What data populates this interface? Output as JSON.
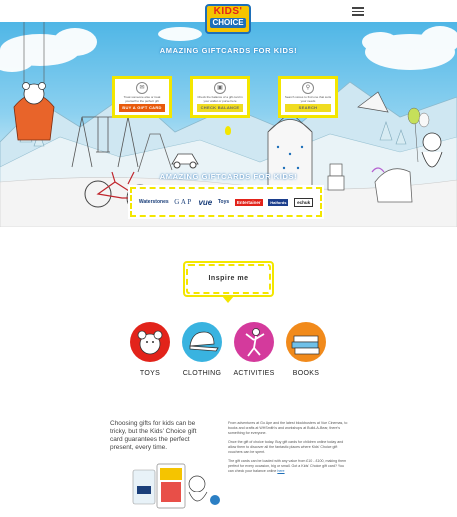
{
  "header": {
    "logo_line1": "KIDS'",
    "logo_line2": "CHOICE",
    "menu_icon": "hamburger-icon"
  },
  "hero": {
    "title": "AMAZING GIFTCARDS FOR KIDS!",
    "title_repeat": "AMAZING GIFTCARDS FOR KIDS!",
    "cards": [
      {
        "text": "Treat someone else or treat yourself to the perfect gift",
        "button": "BUY A GIFT CARD",
        "icon": "gift-card-icon"
      },
      {
        "text": "Check the balance of a gift card in your wallet or purse here",
        "button": "CHECK BALANCE",
        "icon": "card-reader-icon"
      },
      {
        "text": "Search stores to find one that suits your needs",
        "button": "SEARCH",
        "icon": "search-icon"
      }
    ],
    "brands": [
      "Waterstones",
      "GAP",
      "vue",
      "Toys",
      "Entertainer",
      "Halfords",
      "echuk"
    ]
  },
  "inspire": {
    "label": "Inspire me"
  },
  "categories": [
    {
      "label": "TOYS",
      "color": "#e2231a"
    },
    {
      "label": "CLOTHING",
      "color": "#39b3e0"
    },
    {
      "label": "ACTIVITIES",
      "color": "#d43a9c"
    },
    {
      "label": "BOOKS",
      "color": "#f18a1b"
    }
  ],
  "bottom": {
    "intro": "Choosing gifts for kids can be tricky, but the Kids' Choice gift card guarantees the perfect present, every time.",
    "para1": "From adventures at Go Ape and the latest blockbusters at Vue Cinemas, to books and crafts at WHSmith's and workshops at Build-A-Bear, there's something for everyone.",
    "para2": "Once the gift of choice today. Buy gift cards for children online today and allow them to discover all the fantastic places where Kids' Choice gift vouchers can be spent.",
    "para3_before": "The gift cards can be loaded with any value from £10 - £100, making them perfect for every occasion, big or small. Got a Kids' Choice gift card? You can check your balance online ",
    "para3_link": "here"
  },
  "colors": {
    "accent_yellow": "#f3e600",
    "brand_blue": "#1e6fb8",
    "buy_orange": "#e85a0c"
  }
}
